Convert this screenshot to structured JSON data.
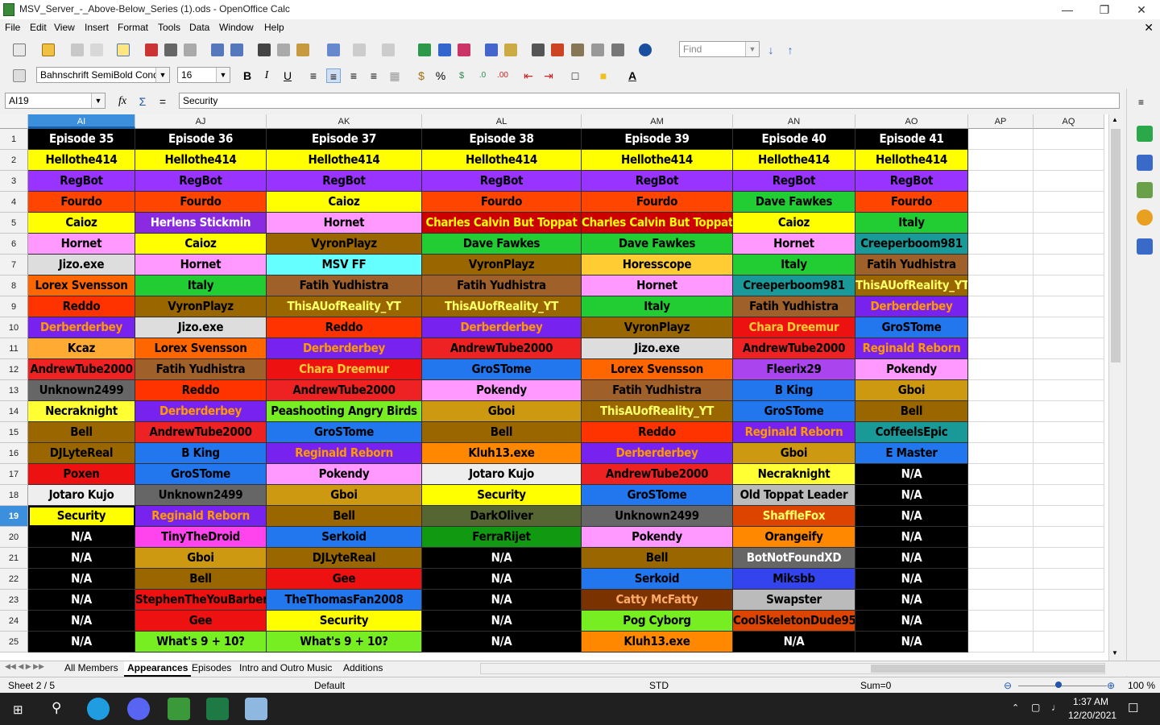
{
  "window": {
    "title": "MSV_Server_-_Above-Below_Series (1).ods - OpenOffice Calc"
  },
  "menu": [
    "File",
    "Edit",
    "View",
    "Insert",
    "Format",
    "Tools",
    "Data",
    "Window",
    "Help"
  ],
  "toolbar": {
    "find_placeholder": "Find",
    "font_name": "Bahnschrift SemiBold Cond",
    "font_size": "16"
  },
  "formula": {
    "cell_ref": "AI19",
    "content": "Security"
  },
  "columns": [
    "AI",
    "AJ",
    "AK",
    "AL",
    "AM",
    "AN",
    "AO",
    "AP",
    "AQ"
  ],
  "rows": [
    [
      "Episode 35",
      "Episode 36",
      "Episode 37",
      "Episode 38",
      "Episode 39",
      "Episode 40",
      "Episode 41"
    ],
    [
      "Hellothe414",
      "Hellothe414",
      "Hellothe414",
      "Hellothe414",
      "Hellothe414",
      "Hellothe414",
      "Hellothe414"
    ],
    [
      "RegBot",
      "RegBot",
      "RegBot",
      "RegBot",
      "RegBot",
      "RegBot",
      "RegBot"
    ],
    [
      "Fourdo",
      "Fourdo",
      "Caioz",
      "Fourdo",
      "Fourdo",
      "Dave Fawkes",
      "Fourdo"
    ],
    [
      "Caioz",
      "Herlens Stickmin",
      "Hornet",
      "Charles Calvin But Toppat",
      "Charles Calvin But Toppat",
      "Caioz",
      "Italy"
    ],
    [
      "Hornet",
      "Caioz",
      "VyronPlayz",
      "Dave Fawkes",
      "Dave Fawkes",
      "Hornet",
      "Creeperboom981"
    ],
    [
      "Jizo.exe",
      "Hornet",
      "MSV FF",
      "VyronPlayz",
      "Horesscope",
      "Italy",
      "Fatih Yudhistra"
    ],
    [
      "Lorex Svensson",
      "Italy",
      "Fatih Yudhistra",
      "Fatih Yudhistra",
      "Hornet",
      "Creeperboom981",
      "ThisAUofReality_YT"
    ],
    [
      "Reddo",
      "VyronPlayz",
      "ThisAUofReality_YT",
      "ThisAUofReality_YT",
      "Italy",
      "Fatih Yudhistra",
      "Derberderbey"
    ],
    [
      "Derberderbey",
      "Jizo.exe",
      "Reddo",
      "Derberderbey",
      "VyronPlayz",
      "Chara Dreemur",
      "GroSTome"
    ],
    [
      "Kcaz",
      "Lorex Svensson",
      "Derberderbey",
      "AndrewTube2000",
      "Jizo.exe",
      "AndrewTube2000",
      "Reginald Reborn"
    ],
    [
      "AndrewTube2000",
      "Fatih Yudhistra",
      "Chara Dreemur",
      "GroSTome",
      "Lorex Svensson",
      "Fleerix29",
      "Pokendy"
    ],
    [
      "Unknown2499",
      "Reddo",
      "AndrewTube2000",
      "Pokendy",
      "Fatih Yudhistra",
      "B King",
      "Gboi"
    ],
    [
      "Necraknight",
      "Derberderbey",
      "Peashooting Angry Birds",
      "Gboi",
      "ThisAUofReality_YT",
      "GroSTome",
      "Bell"
    ],
    [
      "Bell",
      "AndrewTube2000",
      "GroSTome",
      "Bell",
      "Reddo",
      "Reginald Reborn",
      "CoffeelsEpic"
    ],
    [
      "DJLyteReal",
      "B King",
      "Reginald Reborn",
      "Kluh13.exe",
      "Derberderbey",
      "Gboi",
      "E Master"
    ],
    [
      "Poxen",
      "GroSTome",
      "Pokendy",
      "Jotaro Kujo",
      "AndrewTube2000",
      "Necraknight",
      "N/A"
    ],
    [
      "Jotaro Kujo",
      "Unknown2499",
      "Gboi",
      "Security",
      "GroSTome",
      "Old Toppat Leader",
      "N/A"
    ],
    [
      "Security",
      "Reginald Reborn",
      "Bell",
      "DarkOliver",
      "Unknown2499",
      "ShaffleFox",
      "N/A"
    ],
    [
      "N/A",
      "TinyTheDroid",
      "Serkoid",
      "FerraRijet",
      "Pokendy",
      "Orangeify",
      "N/A"
    ],
    [
      "N/A",
      "Gboi",
      "DJLyteReal",
      "N/A",
      "Bell",
      "BotNotFoundXD",
      "N/A"
    ],
    [
      "N/A",
      "Bell",
      "Gee",
      "N/A",
      "Serkoid",
      "Miksbb",
      "N/A"
    ],
    [
      "N/A",
      "StephenTheYouBarber",
      "TheThomasFan2008",
      "N/A",
      "Catty McFatty",
      "Swapster",
      "N/A"
    ],
    [
      "N/A",
      "Gee",
      "Security",
      "N/A",
      "Pog Cyborg",
      "CoolSkeletonDude95",
      "N/A"
    ],
    [
      "N/A",
      "What's 9 + 10?",
      "What's 9 + 10?",
      "N/A",
      "Kluh13.exe",
      "N/A",
      "N/A"
    ]
  ],
  "name_colors": {
    "Episode": [
      "#000000",
      "#ffffff"
    ],
    "Hellothe414": [
      "#ffff00",
      "#000000"
    ],
    "RegBot": [
      "#9933ff",
      "#000000"
    ],
    "Fourdo": [
      "#ff4500",
      "#000000"
    ],
    "Caioz": [
      "#ffff00",
      "#000000"
    ],
    "Dave Fawkes": [
      "#22cc33",
      "#000000"
    ],
    "Herlens Stickmin": [
      "#8a2be2",
      "#ffffff"
    ],
    "Hornet": [
      "#ff99ff",
      "#000000"
    ],
    "Charles Calvin But Toppat": [
      "#cc0000",
      "#ffff00"
    ],
    "Italy": [
      "#22cc33",
      "#000000"
    ],
    "VyronPlayz": [
      "#996600",
      "#000000"
    ],
    "Creeperboom981": [
      "#1a9999",
      "#000000"
    ],
    "Jizo.exe": [
      "#dddddd",
      "#000000"
    ],
    "MSV FF": [
      "#66ffff",
      "#000000"
    ],
    "Horesscope": [
      "#ffcc33",
      "#000000"
    ],
    "Fatih Yudhistra": [
      "#a0602a",
      "#000000"
    ],
    "Lorex Svensson": [
      "#ff6600",
      "#000000"
    ],
    "ThisAUofReality_YT": [
      "#996600",
      "#ffff66"
    ],
    "Reddo": [
      "#ff3300",
      "#000000"
    ],
    "Derberderbey": [
      "#7722ee",
      "#ff9900"
    ],
    "Chara Dreemur": [
      "#ee1111",
      "#ffcc33"
    ],
    "GroSTome": [
      "#2277ee",
      "#000000"
    ],
    "Kcaz": [
      "#ffaa33",
      "#000000"
    ],
    "AndrewTube2000": [
      "#ee2222",
      "#000000"
    ],
    "Reginald Reborn": [
      "#7722ee",
      "#ff9900"
    ],
    "Fleerix29": [
      "#aa44ee",
      "#000000"
    ],
    "Pokendy": [
      "#ff99ff",
      "#000000"
    ],
    "Unknown2499": [
      "#666666",
      "#000000"
    ],
    "B King": [
      "#2277ee",
      "#000000"
    ],
    "Gboi": [
      "#cc9911",
      "#000000"
    ],
    "Necraknight": [
      "#ffff33",
      "#000000"
    ],
    "Peashooting Angry Birds": [
      "#77ee22",
      "#000000"
    ],
    "Bell": [
      "#996600",
      "#000000"
    ],
    "CoffeelsEpic": [
      "#1a9999",
      "#000000"
    ],
    "DJLyteReal": [
      "#996600",
      "#000000"
    ],
    "Kluh13.exe": [
      "#ff8800",
      "#000000"
    ],
    "E Master": [
      "#2277ee",
      "#000000"
    ],
    "Poxen": [
      "#ee1111",
      "#000000"
    ],
    "Jotaro Kujo": [
      "#eeeeee",
      "#000000"
    ],
    "Security": [
      "#ffff00",
      "#000000"
    ],
    "Old Toppat Leader": [
      "#bbbbbb",
      "#000000"
    ],
    "DarkOliver": [
      "#556633",
      "#000000"
    ],
    "ShaffleFox": [
      "#dd4400",
      "#ffff66"
    ],
    "TinyTheDroid": [
      "#ff44ee",
      "#000000"
    ],
    "Serkoid": [
      "#2277ee",
      "#000000"
    ],
    "FerraRijet": [
      "#119911",
      "#000000"
    ],
    "Orangeify": [
      "#ff8800",
      "#000000"
    ],
    "N/A": [
      "#000000",
      "#ffffff"
    ],
    "BotNotFoundXD": [
      "#666666",
      "#ffffff"
    ],
    "Gee": [
      "#ee1111",
      "#000000"
    ],
    "Miksbb": [
      "#3344ee",
      "#000000"
    ],
    "StephenTheYouBarber": [
      "#ee1111",
      "#000000"
    ],
    "TheThomasFan2008": [
      "#2277ee",
      "#000000"
    ],
    "Catty McFatty": [
      "#7a3300",
      "#ffaa66"
    ],
    "Swapster": [
      "#bbbbbb",
      "#000000"
    ],
    "Pog Cyborg": [
      "#77ee22",
      "#000000"
    ],
    "CoolSkeletonDude95": [
      "#dd4400",
      "#000000"
    ],
    "What's 9 + 10?": [
      "#77ee22",
      "#000000"
    ]
  },
  "tabs": [
    "All Members",
    "Appearances",
    "Episodes",
    "Intro and Outro Music",
    "Additions"
  ],
  "active_tab": "Appearances",
  "status": {
    "sheet": "Sheet 2 / 5",
    "style": "Default",
    "mode": "STD",
    "sum": "Sum=0",
    "zoom": "100 %"
  },
  "taskbar": {
    "time": "1:37 AM",
    "date": "12/20/2021"
  }
}
